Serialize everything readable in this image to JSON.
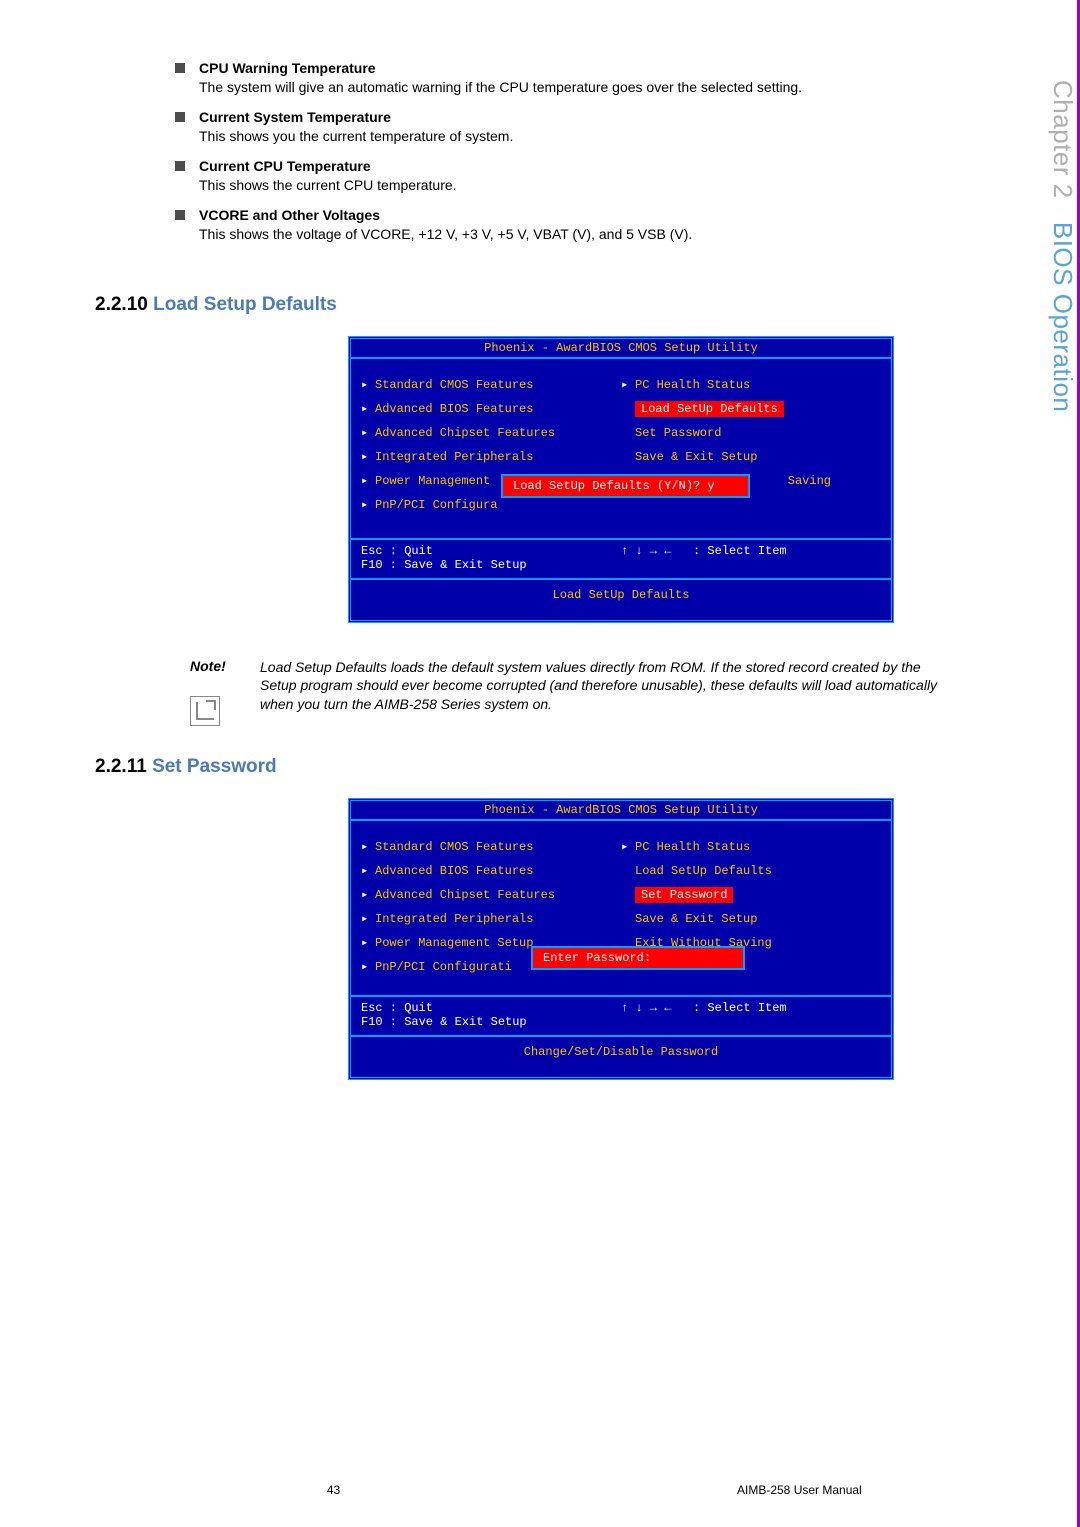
{
  "side_tab": {
    "chapter": "Chapter 2",
    "title": "BIOS Operation"
  },
  "bullets": [
    {
      "title": "CPU Warning Temperature",
      "desc": "The system will give an automatic warning if the CPU temperature goes over the selected setting."
    },
    {
      "title": "Current System Temperature",
      "desc": "This shows you the current temperature of system."
    },
    {
      "title": "Current CPU Temperature",
      "desc": "This shows the current CPU temperature."
    },
    {
      "title": "VCORE and Other Voltages",
      "desc": "This shows the voltage of VCORE, +12 V, +3 V, +5 V, VBAT (V), and 5 VSB (V)."
    }
  ],
  "sections": {
    "s1": {
      "num": "2.2.10",
      "title": "Load Setup Defaults"
    },
    "s2": {
      "num": "2.2.11",
      "title": "Set Password"
    }
  },
  "bios1": {
    "title": "Phoenix - AwardBIOS CMOS Setup Utility",
    "left": [
      {
        "arrow": true,
        "label": "Standard CMOS Features"
      },
      {
        "arrow": true,
        "label": "Advanced BIOS Features"
      },
      {
        "arrow": true,
        "label": "Advanced Chipset Features"
      },
      {
        "arrow": true,
        "label": "Integrated Peripherals"
      },
      {
        "arrow": true,
        "label": "Power Management"
      },
      {
        "arrow": true,
        "label": "PnP/PCI Configura"
      }
    ],
    "right": [
      {
        "arrow": true,
        "label": "PC Health Status"
      },
      {
        "arrow": false,
        "label": "Load SetUp Defaults",
        "highlight": true
      },
      {
        "arrow": false,
        "label": "Set Password"
      },
      {
        "arrow": false,
        "label": "Save & Exit Setup"
      },
      {
        "arrow": false,
        "label": "Saving",
        "rightalign": true
      }
    ],
    "dialog": "Load SetUp Defaults (Y/N)? y",
    "help1l": "Esc : Quit",
    "help1r": "↑ ↓ → ←   : Select Item",
    "help2l": "F10 : Save & Exit Setup",
    "footer": "Load SetUp Defaults"
  },
  "note": {
    "label": "Note!",
    "text": "Load Setup Defaults loads the default system values directly from ROM. If the stored record created by the Setup program should ever become corrupted (and therefore unusable), these defaults will load automatically when you turn the AIMB-258 Series system on."
  },
  "bios2": {
    "title": "Phoenix - AwardBIOS CMOS Setup Utility",
    "left": [
      {
        "arrow": true,
        "label": "Standard CMOS Features"
      },
      {
        "arrow": true,
        "label": "Advanced BIOS Features"
      },
      {
        "arrow": true,
        "label": "Advanced Chipset Features"
      },
      {
        "arrow": true,
        "label": "Integrated Peripherals"
      },
      {
        "arrow": true,
        "label": "Power Management Setup"
      },
      {
        "arrow": true,
        "label": "PnP/PCI Configurati"
      }
    ],
    "right": [
      {
        "arrow": true,
        "label": "PC Health Status"
      },
      {
        "arrow": false,
        "label": "Load SetUp Defaults"
      },
      {
        "arrow": false,
        "label": "Set Password",
        "highlight": true
      },
      {
        "arrow": false,
        "label": "Save & Exit Setup"
      },
      {
        "arrow": false,
        "label": "Exit Without Saving"
      }
    ],
    "dialog": "Enter Password:",
    "help1l": "Esc : Quit",
    "help1r": "↑ ↓ → ←   : Select Item",
    "help2l": "F10 : Save & Exit Setup",
    "footer": "Change/Set/Disable Password"
  },
  "page_footer": {
    "num": "43",
    "doc": "AIMB-258 User Manual"
  }
}
